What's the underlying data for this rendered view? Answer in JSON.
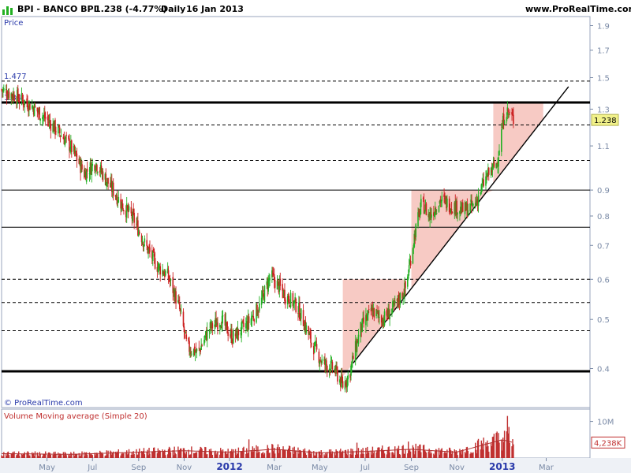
{
  "header": {
    "symbol": "BPI - BANCO BPI",
    "last": "1.238 (-4.77%)",
    "period": "Daily",
    "date": "16 Jan 2013",
    "source": "www.ProRealTime.com"
  },
  "panels": {
    "price_title": "Price",
    "volume_title": "Volume Moving average (Simple 20)",
    "watermark": "© ProRealTime.com"
  },
  "colors": {
    "up": "#22b022",
    "down": "#cc2020",
    "highlight": "#f4b8b0",
    "axis": "#7a8aa6",
    "volume_label": "#c03030",
    "label_blue": "#2a3aaa",
    "badge": "#f2f28a"
  },
  "chart_data": [
    {
      "type": "candlestick",
      "title": "BPI - BANCO BPI",
      "y_scale": "log",
      "ylim": [
        0.335,
        1.98
      ],
      "y_ticks": [
        "1.9",
        "1.7",
        "1.5",
        "1.3",
        "1.1",
        "0.9",
        "0.8",
        "0.7",
        "0.6",
        "0.5",
        "0.4"
      ],
      "x_ticks": [
        "May",
        "Jul",
        "Sep",
        "Nov",
        "2012",
        "Mar",
        "May",
        "Jul",
        "Sep",
        "Nov",
        "2013",
        "Mar"
      ],
      "x_tick_dates": [
        "2011-05-01",
        "2011-07-01",
        "2011-09-01",
        "2011-11-01",
        "2012-01-01",
        "2012-03-01",
        "2012-05-01",
        "2012-07-01",
        "2012-09-01",
        "2012-11-01",
        "2013-01-01",
        "2013-03-01"
      ],
      "x_range": [
        "2011-03-01",
        "2013-04-15"
      ],
      "last_value_label": "1.238",
      "price_path": [
        [
          "2011-03-01",
          1.42
        ],
        [
          "2011-03-20",
          1.38
        ],
        [
          "2011-04-10",
          1.32
        ],
        [
          "2011-04-28",
          1.25
        ],
        [
          "2011-05-15",
          1.18
        ],
        [
          "2011-06-01",
          1.1
        ],
        [
          "2011-06-20",
          0.97
        ],
        [
          "2011-07-05",
          1.02
        ],
        [
          "2011-07-20",
          0.94
        ],
        [
          "2011-08-10",
          0.84
        ],
        [
          "2011-08-25",
          0.79
        ],
        [
          "2011-09-10",
          0.7
        ],
        [
          "2011-09-25",
          0.64
        ],
        [
          "2011-10-10",
          0.61
        ],
        [
          "2011-10-25",
          0.53
        ],
        [
          "2011-11-05",
          0.44
        ],
        [
          "2011-11-20",
          0.43
        ],
        [
          "2011-12-05",
          0.48
        ],
        [
          "2011-12-20",
          0.5
        ],
        [
          "2012-01-05",
          0.46
        ],
        [
          "2012-01-25",
          0.49
        ],
        [
          "2012-02-10",
          0.53
        ],
        [
          "2012-02-25",
          0.61
        ],
        [
          "2012-03-15",
          0.56
        ],
        [
          "2012-04-01",
          0.53
        ],
        [
          "2012-04-20",
          0.45
        ],
        [
          "2012-05-05",
          0.41
        ],
        [
          "2012-05-20",
          0.4
        ],
        [
          "2012-06-01",
          0.37
        ],
        [
          "2012-06-10",
          0.39
        ],
        [
          "2012-06-25",
          0.48
        ],
        [
          "2012-07-10",
          0.52
        ],
        [
          "2012-07-25",
          0.5
        ],
        [
          "2012-08-10",
          0.53
        ],
        [
          "2012-08-25",
          0.58
        ],
        [
          "2012-09-05",
          0.73
        ],
        [
          "2012-09-15",
          0.85
        ],
        [
          "2012-09-25",
          0.8
        ],
        [
          "2012-10-10",
          0.86
        ],
        [
          "2012-10-25",
          0.84
        ],
        [
          "2012-11-10",
          0.82
        ],
        [
          "2012-11-25",
          0.84
        ],
        [
          "2012-12-10",
          0.95
        ],
        [
          "2012-12-25",
          1.02
        ],
        [
          "2013-01-05",
          1.3
        ],
        [
          "2013-01-16",
          1.238
        ]
      ],
      "horizontal_levels": [
        {
          "value": 1.477,
          "style": "dashed",
          "label": "1.477"
        },
        {
          "value": 1.34,
          "style": "bold",
          "label": "1.34"
        },
        {
          "value": 1.21,
          "style": "dashed"
        },
        {
          "value": 1.03,
          "style": "dashed"
        },
        {
          "value": 0.9,
          "style": "solid"
        },
        {
          "value": 0.76,
          "style": "solid"
        },
        {
          "value": 0.6,
          "style": "dashed"
        },
        {
          "value": 0.54,
          "style": "dashed"
        },
        {
          "value": 0.475,
          "style": "dashed"
        },
        {
          "value": 0.395,
          "style": "bold"
        }
      ],
      "trendline": [
        [
          "2012-06-15",
          0.41
        ],
        [
          "2013-03-31",
          1.44
        ]
      ],
      "highlight_zones": [
        {
          "from": [
            "2012-06-01",
            0.6
          ],
          "to": [
            "2012-08-25",
            0.6
          ],
          "base": [
            "2012-06-15",
            0.41
          ]
        },
        {
          "from": [
            "2012-09-01",
            0.9
          ],
          "to": [
            "2012-12-20",
            0.9
          ]
        },
        {
          "from": [
            "2012-12-20",
            1.34
          ],
          "to": [
            "2013-02-25",
            1.34
          ]
        }
      ]
    },
    {
      "type": "bar",
      "title": "Volume Moving average (Simple 20)",
      "y_ticks": [
        "10M"
      ],
      "last_value_label": "4,238K",
      "volume_path": [
        [
          "2011-03-01",
          1.2
        ],
        [
          "2011-06-01",
          1.0
        ],
        [
          "2011-09-01",
          1.6
        ],
        [
          "2011-11-01",
          2.0
        ],
        [
          "2012-01-01",
          1.6
        ],
        [
          "2012-03-01",
          2.4
        ],
        [
          "2012-05-01",
          1.4
        ],
        [
          "2012-07-01",
          1.8
        ],
        [
          "2012-09-01",
          2.4
        ],
        [
          "2012-11-01",
          1.6
        ],
        [
          "2013-01-01",
          5.0
        ],
        [
          "2013-01-16",
          4.238
        ]
      ],
      "volume_spikes": [
        [
          "2012-01-27",
          5.1
        ],
        [
          "2012-06-20",
          4.2
        ],
        [
          "2012-08-28",
          4.5
        ],
        [
          "2013-01-08",
          11.5
        ],
        [
          "2013-01-10",
          8.5
        ]
      ]
    }
  ]
}
